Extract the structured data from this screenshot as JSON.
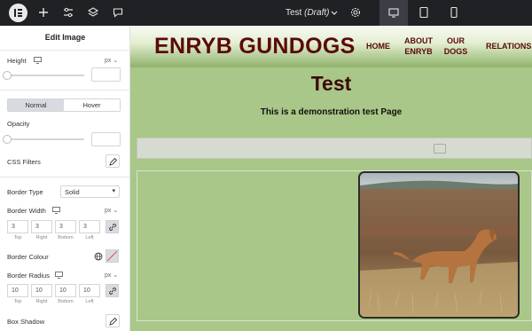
{
  "topbar": {
    "doc_title": "Test",
    "doc_status": "(Draft)",
    "icons": [
      "elementor-logo-icon",
      "plus-icon",
      "sliders-icon",
      "layers-icon",
      "comment-icon",
      "chevron-down-icon",
      "gear-icon",
      "desktop-icon",
      "tablet-icon",
      "mobile-icon"
    ]
  },
  "panel": {
    "title": "Edit Image",
    "height_label": "Height",
    "height_unit": "px",
    "tabs": [
      "Normal",
      "Hover"
    ],
    "opacity_label": "Opacity",
    "css_filters_label": "CSS Filters",
    "border_type_label": "Border Type",
    "border_type_value": "Solid",
    "border_width_label": "Border Width",
    "border_width_unit": "px",
    "border_width_values": [
      "3",
      "3",
      "3",
      "3"
    ],
    "side_captions": [
      "Top",
      "Right",
      "Bottom",
      "Left"
    ],
    "border_colour_label": "Border Colour",
    "border_radius_label": "Border Radius",
    "border_radius_unit": "px",
    "border_radius_values": [
      "10",
      "10",
      "10",
      "10"
    ],
    "box_shadow_label": "Box Shadow"
  },
  "site": {
    "title": "ENRYB GUNDOGS",
    "nav": [
      "HOME",
      "ABOUT ENRYB",
      "OUR DOGS",
      "RELATIONS"
    ],
    "page_title": "Test",
    "page_subtitle": "This is a demonstration test Page"
  },
  "colors": {
    "topbar_bg": "#1f2124",
    "site_title": "#5a0a0a",
    "page_bg": "#a9c788",
    "active_tab": "#d7dadf"
  }
}
